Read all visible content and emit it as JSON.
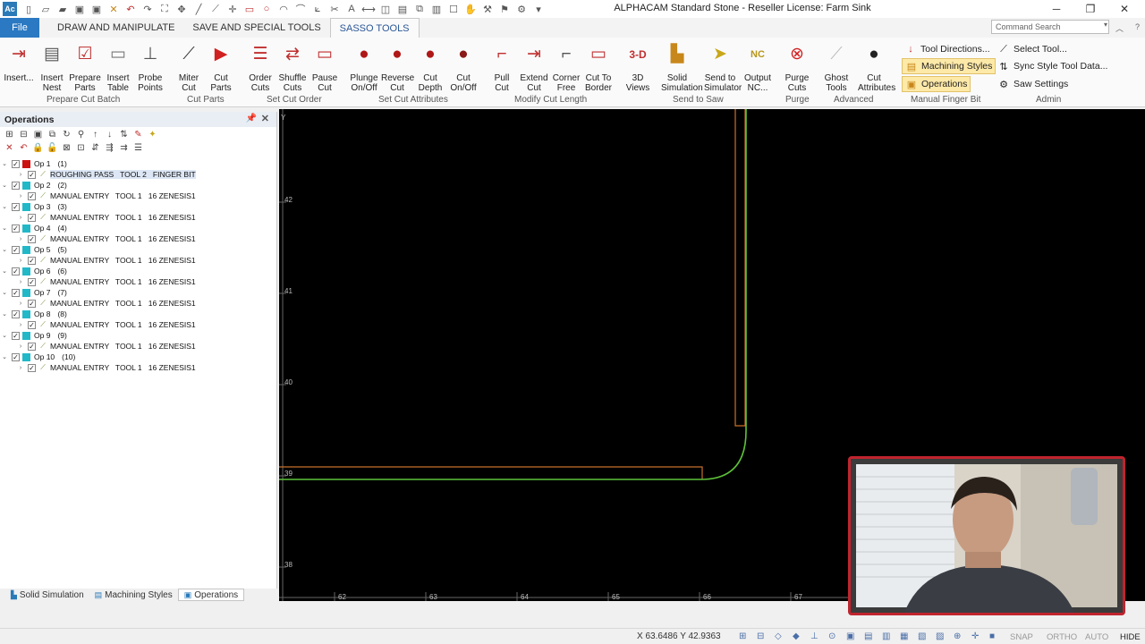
{
  "window": {
    "title": "ALPHACAM Standard Stone - Reseller License: Farm Sink",
    "app_icon_text": "Ac"
  },
  "tabs": {
    "file": "File",
    "draw": "DRAW AND MANIPULATE",
    "save": "SAVE AND SPECIAL TOOLS",
    "sasso": "SASSO TOOLS"
  },
  "search": {
    "placeholder": "Command Search"
  },
  "ribbon": {
    "buttons": [
      {
        "label": "Insert..."
      },
      {
        "label": "Insert\nNest"
      },
      {
        "label": "Prepare\nParts"
      },
      {
        "label": "Insert\nTable"
      },
      {
        "label": "Probe\nPoints"
      },
      {
        "label": "Miter\nCut"
      },
      {
        "label": "Cut\nParts"
      },
      {
        "label": "Order\nCuts"
      },
      {
        "label": "Shuffle\nCuts"
      },
      {
        "label": "Pause\nCut"
      },
      {
        "label": "Plunge\nOn/Off"
      },
      {
        "label": "Reverse\nCut"
      },
      {
        "label": "Cut\nDepth"
      },
      {
        "label": "Cut\nOn/Off"
      },
      {
        "label": "Pull\nCut"
      },
      {
        "label": "Extend\nCut"
      },
      {
        "label": "Corner\nFree"
      },
      {
        "label": "Cut To\nBorder"
      },
      {
        "label": "3D\nViews"
      },
      {
        "label": "Solid\nSimulation"
      },
      {
        "label": "Send to\nSimulator"
      },
      {
        "label": "Output\nNC..."
      },
      {
        "label": "Purge\nCuts"
      },
      {
        "label": "Ghost\nTools"
      },
      {
        "label": "Cut\nAttributes"
      }
    ],
    "groups": {
      "prepare": "Prepare Cut Batch",
      "cut_parts": "Cut Parts",
      "set_cut_order": "Set Cut Order",
      "set_cut_attributes": "Set Cut Attributes",
      "modify": "Modify Cut Length",
      "send": "Send to Saw",
      "purge": "Purge",
      "advanced": "Advanced",
      "manual": "Manual Finger Bit",
      "admin": "Admin"
    },
    "small": {
      "tool_directions": "Tool Directions...",
      "machining_styles": "Machining Styles",
      "operations": "Operations",
      "select_tool": "Select Tool...",
      "sync_style": "Sync Style Tool Data...",
      "saw_settings": "Saw Settings"
    }
  },
  "operations_panel": {
    "title": "Operations",
    "ops": [
      {
        "name": "Op 1",
        "count": "(1)",
        "color": "#cc1111",
        "sub": "ROUGHING PASS   TOOL 2   FINGER BIT",
        "selected": true
      },
      {
        "name": "Op 2",
        "count": "(2)",
        "color": "#22b8c8",
        "sub": "MANUAL ENTRY   TOOL 1   16 ZENESIS1"
      },
      {
        "name": "Op 3",
        "count": "(3)",
        "color": "#22b8c8",
        "sub": "MANUAL ENTRY   TOOL 1   16 ZENESIS1"
      },
      {
        "name": "Op 4",
        "count": "(4)",
        "color": "#22b8c8",
        "sub": "MANUAL ENTRY   TOOL 1   16 ZENESIS1"
      },
      {
        "name": "Op 5",
        "count": "(5)",
        "color": "#22b8c8",
        "sub": "MANUAL ENTRY   TOOL 1   16 ZENESIS1"
      },
      {
        "name": "Op 6",
        "count": "(6)",
        "color": "#22b8c8",
        "sub": "MANUAL ENTRY   TOOL 1   16 ZENESIS1"
      },
      {
        "name": "Op 7",
        "count": "(7)",
        "color": "#22b8c8",
        "sub": "MANUAL ENTRY   TOOL 1   16 ZENESIS1"
      },
      {
        "name": "Op 8",
        "count": "(8)",
        "color": "#22b8c8",
        "sub": "MANUAL ENTRY   TOOL 1   16 ZENESIS1"
      },
      {
        "name": "Op 9",
        "count": "(9)",
        "color": "#22b8c8",
        "sub": "MANUAL ENTRY   TOOL 1   16 ZENESIS1"
      },
      {
        "name": "Op 10",
        "count": "(10)",
        "color": "#22b8c8",
        "sub": "MANUAL ENTRY   TOOL 1   16 ZENESIS1"
      }
    ]
  },
  "bottom_tabs": {
    "solid": "Solid Simulation",
    "styles": "Machining Styles",
    "operations": "Operations"
  },
  "canvas": {
    "axis_letter": "Y",
    "y_ticks": [
      "42",
      "41",
      "40",
      "39",
      "38"
    ],
    "x_ticks": [
      "62",
      "63",
      "64",
      "65",
      "66",
      "67"
    ]
  },
  "statusbar": {
    "coords": "X 63.6486    Y 42.9363",
    "snap": "SNAP",
    "ortho": "ORTHO",
    "auto": "AUTO",
    "hide": "HIDE"
  },
  "colors": {
    "green_path": "#5ec23a",
    "orange_path": "#c8712a",
    "accent": "#2b79c2"
  }
}
